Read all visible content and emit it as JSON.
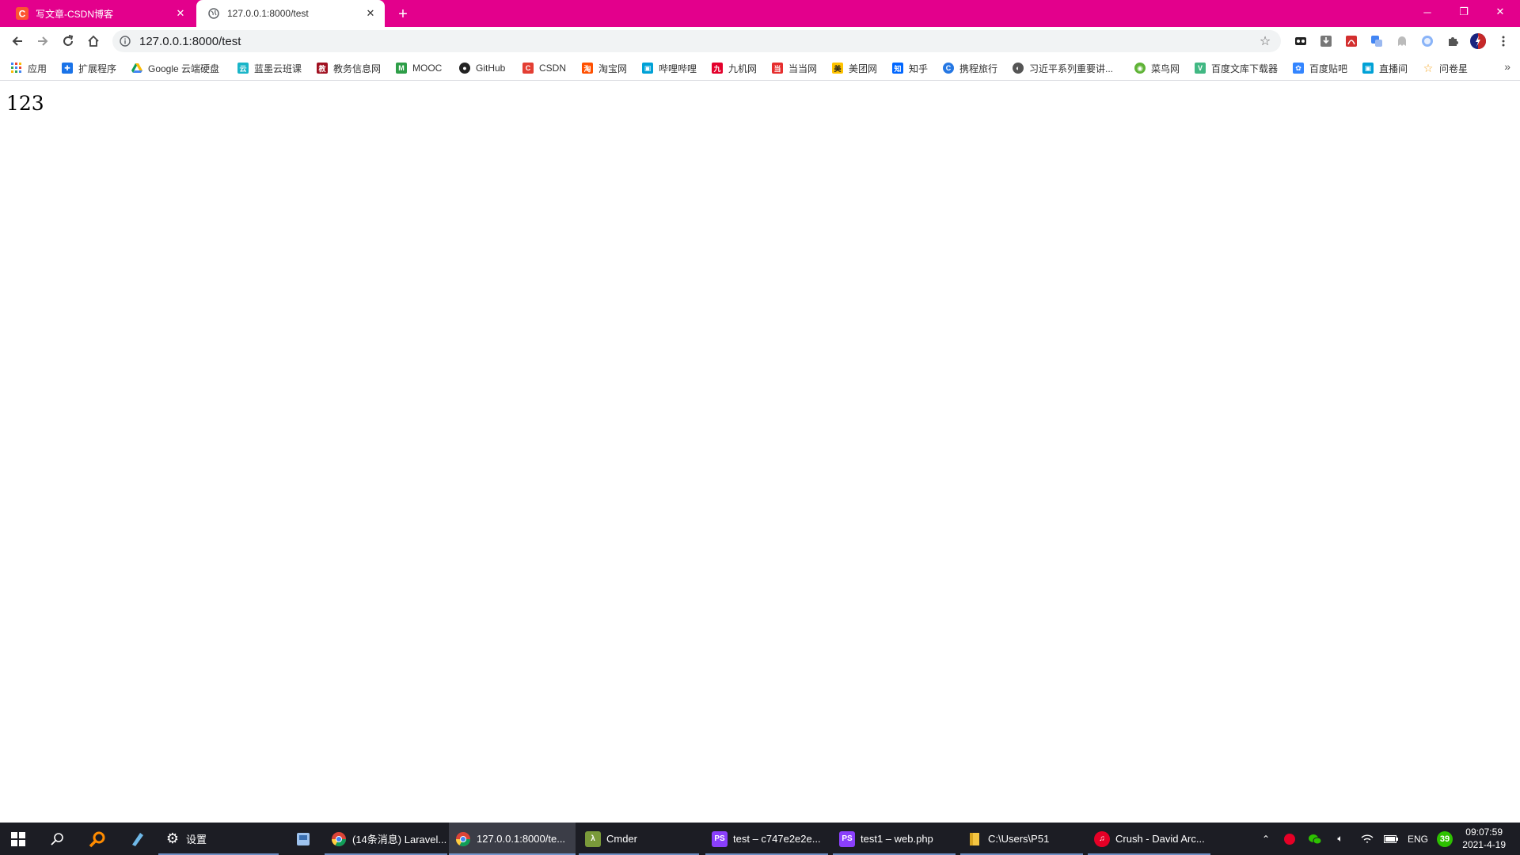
{
  "browser": {
    "tabs": [
      {
        "title": "写文章-CSDN博客",
        "icon": "csdn-icon",
        "active": false
      },
      {
        "title": "127.0.0.1:8000/test",
        "icon": "globe-icon",
        "active": true
      }
    ],
    "address_bar": {
      "url": "127.0.0.1:8000/test"
    },
    "theme_color": "#e3008c",
    "bookmarks": [
      {
        "label": "应用",
        "icon": "apps-grid-icon",
        "color": "#4285f4"
      },
      {
        "label": "扩展程序",
        "icon": "puzzle-icon",
        "color": "#1a73e8"
      },
      {
        "label": "Google 云端硬盘",
        "icon": "drive-icon",
        "color": "#0f9d58"
      },
      {
        "label": "蓝墨云班课",
        "icon": "mosoteach-icon",
        "color": "#19b5c8"
      },
      {
        "label": "教务信息网",
        "icon": "jiao-icon",
        "color": "#a01020"
      },
      {
        "label": "MOOC",
        "icon": "mooc-icon",
        "color": "#2e9e48"
      },
      {
        "label": "GitHub",
        "icon": "github-icon",
        "color": "#222222"
      },
      {
        "label": "CSDN",
        "icon": "csdn-icon",
        "color": "#e33e33"
      },
      {
        "label": "淘宝网",
        "icon": "taobao-icon",
        "color": "#ff5000"
      },
      {
        "label": "哔哩哔哩",
        "icon": "bilibili-icon",
        "color": "#00a1d6"
      },
      {
        "label": "九机网",
        "icon": "jiuji-icon",
        "color": "#e3002b"
      },
      {
        "label": "当当网",
        "icon": "dangdang-icon",
        "color": "#e62e2e"
      },
      {
        "label": "美团网",
        "icon": "meituan-icon",
        "color": "#ffc300"
      },
      {
        "label": "知乎",
        "icon": "zhihu-icon",
        "color": "#0066ff"
      },
      {
        "label": "携程旅行",
        "icon": "ctrip-icon",
        "color": "#2577e3"
      },
      {
        "label": "习近平系列重要讲...",
        "icon": "globe-icon",
        "color": "#555555"
      },
      {
        "label": "菜鸟网",
        "icon": "runoob-icon",
        "color": "#5fb336"
      },
      {
        "label": "百度文库下载器",
        "icon": "vue-icon",
        "color": "#41b883"
      },
      {
        "label": "百度贴吧",
        "icon": "baidu-paw-icon",
        "color": "#3385ff"
      },
      {
        "label": "直播间",
        "icon": "bilibili-icon",
        "color": "#00a1d6"
      },
      {
        "label": "问卷星",
        "icon": "star-icon",
        "color": "#f5a623"
      }
    ]
  },
  "page": {
    "body_text": "123"
  },
  "taskbar": {
    "pinned": [
      {
        "label": "设置",
        "icon": "gear-icon"
      }
    ],
    "apps": [
      {
        "label": "(14条消息) Laravel...",
        "icon": "chrome-icon",
        "color": "#4285f4",
        "active": false
      },
      {
        "label": "127.0.0.1:8000/te...",
        "icon": "chrome-icon",
        "color": "#4285f4",
        "active": true
      },
      {
        "label": "Cmder",
        "icon": "cmder-icon",
        "color": "#7a9a3a",
        "active": false
      },
      {
        "label": "test – c747e2e2e...",
        "icon": "phpstorm-icon",
        "color": "#8a3ffc",
        "active": false
      },
      {
        "label": "test1 – web.php",
        "icon": "phpstorm-icon",
        "color": "#8a3ffc",
        "active": false
      },
      {
        "label": "C:\\Users\\P51",
        "icon": "folder-icon",
        "color": "#f4c542",
        "active": false
      },
      {
        "label": "Crush - David Arc...",
        "icon": "netease-music-icon",
        "color": "#e60026",
        "active": false
      }
    ],
    "tray": {
      "language": "ENG",
      "badge": "39",
      "time": "09:07:59",
      "date": "2021-4-19"
    }
  }
}
